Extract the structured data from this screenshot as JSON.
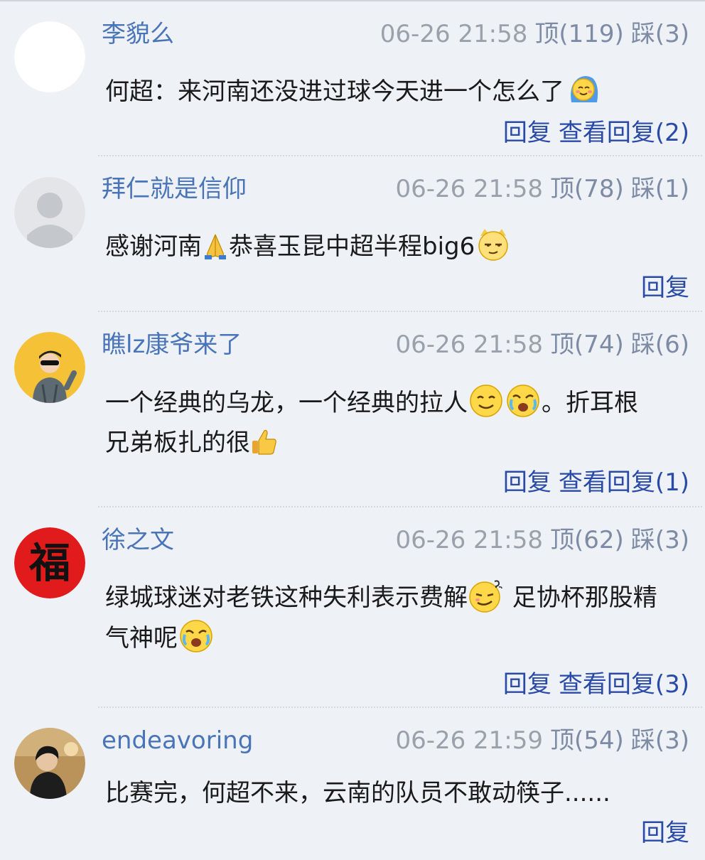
{
  "comments": [
    {
      "username": "李貌么",
      "time": "06-26 21:58",
      "ding_label": "顶",
      "ding_count": "(119)",
      "cai_label": "踩",
      "cai_count": "(3)",
      "text_1": "何超：来河南还没进过球今天进一个怎么了",
      "reply_label": "回复",
      "view_replies_label": "查看回复(2)",
      "emojis": [
        "shy-face-emoji"
      ]
    },
    {
      "username": "拜仁就是信仰",
      "time": "06-26 21:58",
      "ding_label": "顶",
      "ding_count": "(78)",
      "cai_label": "踩",
      "cai_count": "(1)",
      "text_1": "感谢河南",
      "text_2": "恭喜玉昆中超半程big6",
      "reply_label": "回复",
      "emojis": [
        "pray-hands-emoji",
        "smug-face-emoji"
      ]
    },
    {
      "username": "瞧lz康爷来了",
      "time": "06-26 21:58",
      "ding_label": "顶",
      "ding_count": "(74)",
      "cai_label": "踩",
      "cai_count": "(6)",
      "text_1": "一个经典的乌龙，一个经典的拉人",
      "text_2": "。折耳根",
      "text_3": "兄弟板扎的很",
      "reply_label": "回复",
      "view_replies_label": "查看回复(1)",
      "emojis": [
        "smile-face-emoji",
        "crying-face-emoji",
        "thumbs-up-emoji"
      ]
    },
    {
      "username": "徐之文",
      "time": "06-26 21:58",
      "ding_label": "顶",
      "ding_count": "(62)",
      "cai_label": "踩",
      "cai_count": "(3)",
      "text_1": "绿城球迷对老铁这种失利表示费解",
      "text_2": " 足协杯那股精",
      "text_3": "气神呢",
      "reply_label": "回复",
      "view_replies_label": "查看回复(3)",
      "avatar_char": "福",
      "emojis": [
        "confused-face-emoji",
        "crying-face-emoji"
      ]
    },
    {
      "username": "endeavoring",
      "time": "06-26 21:59",
      "ding_label": "顶",
      "ding_count": "(54)",
      "cai_label": "踩",
      "cai_count": "(3)",
      "text_1": "比赛完，何超不来，云南的队员不敢动筷子......",
      "reply_label": "回复"
    }
  ],
  "colors": {
    "background": "#eef1f6",
    "username": "#4a74b8",
    "meta": "#9aa1ab",
    "action_link": "#2a4aa8"
  }
}
